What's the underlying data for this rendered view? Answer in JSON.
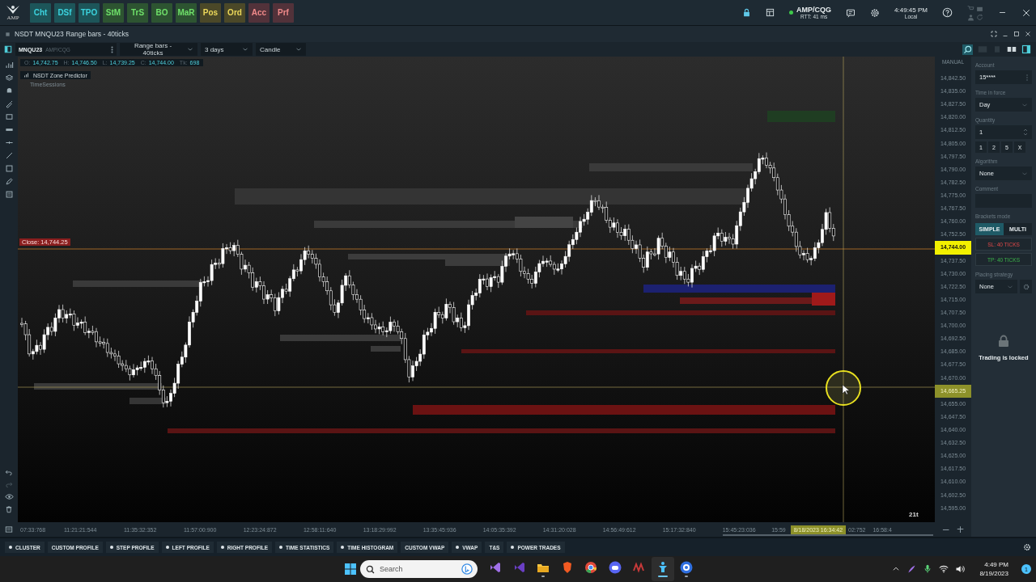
{
  "top_bar": {
    "logo": "AMP",
    "modules": [
      {
        "label": "Cht",
        "color": "#1d5559"
      },
      {
        "label": "DSf",
        "color": "#1d5559"
      },
      {
        "label": "TPO",
        "color": "#1d5559"
      },
      {
        "label": "StM",
        "color": "#2d5431"
      },
      {
        "label": "TrS",
        "color": "#2d5431"
      },
      {
        "label": "BO",
        "color": "#2d5431"
      },
      {
        "label": "MaR",
        "color": "#2d5431"
      },
      {
        "label": "Pos",
        "color": "#4b4828"
      },
      {
        "label": "Ord",
        "color": "#4b4828"
      },
      {
        "label": "Acc",
        "color": "#52323a"
      },
      {
        "label": "Prf",
        "color": "#52323a"
      }
    ],
    "connection": {
      "name": "AMP/CQG",
      "rtt": "RTT: 41 ms",
      "connected": true
    },
    "clock": {
      "time": "4:49:45 PM",
      "zone": "Local"
    }
  },
  "chart_window": {
    "title": "NSDT MNQU23 Range bars - 40ticks",
    "symbol": "MNQU23",
    "feed": "AMP/CQG",
    "bar_type": "Range bars - 40ticks",
    "period": "3 days",
    "style": "Candle"
  },
  "ohlc": [
    {
      "label": "O:",
      "value": "14,742.75"
    },
    {
      "label": "H:",
      "value": "14,746.50"
    },
    {
      "label": "L:",
      "value": "14,739.25"
    },
    {
      "label": "C:",
      "value": "14,744.00"
    },
    {
      "label": "Tk:",
      "value": "698"
    }
  ],
  "indicators": [
    {
      "name": "NSDT Zone Predictor",
      "disabled": false
    },
    {
      "name": "TimeSessions",
      "disabled": true
    }
  ],
  "close_label": "Close: 14,744.25",
  "bar_counter": "21t",
  "price_axis": {
    "mode": "MANUAL",
    "ticks": [
      {
        "text": "14,842.50",
        "kind": "tick"
      },
      {
        "text": "14,835.00",
        "kind": "tick"
      },
      {
        "text": "14,827.50",
        "kind": "tick"
      },
      {
        "text": "14,820.00",
        "kind": "tick"
      },
      {
        "text": "14,812.50",
        "kind": "tick"
      },
      {
        "text": "14,805.00",
        "kind": "tick"
      },
      {
        "text": "14,797.50",
        "kind": "tick"
      },
      {
        "text": "14,790.00",
        "kind": "tick"
      },
      {
        "text": "14,782.50",
        "kind": "tick"
      },
      {
        "text": "14,775.00",
        "kind": "tick"
      },
      {
        "text": "14,767.50",
        "kind": "tick"
      },
      {
        "text": "14,760.00",
        "kind": "tick"
      },
      {
        "text": "14,752.50",
        "kind": "tick"
      },
      {
        "text": "14,744.00",
        "kind": "last"
      },
      {
        "text": "14,737.50",
        "kind": "tick"
      },
      {
        "text": "14,730.00",
        "kind": "tick"
      },
      {
        "text": "14,722.50",
        "kind": "tick"
      },
      {
        "text": "14,715.00",
        "kind": "tick"
      },
      {
        "text": "14,707.50",
        "kind": "tick"
      },
      {
        "text": "14,700.00",
        "kind": "tick"
      },
      {
        "text": "14,692.50",
        "kind": "tick"
      },
      {
        "text": "14,685.00",
        "kind": "tick"
      },
      {
        "text": "14,677.50",
        "kind": "tick"
      },
      {
        "text": "14,670.00",
        "kind": "tick"
      },
      {
        "text": "14,665.25",
        "kind": "cursor"
      },
      {
        "text": "14,655.00",
        "kind": "tick"
      },
      {
        "text": "14,647.50",
        "kind": "tick"
      },
      {
        "text": "14,640.00",
        "kind": "tick"
      },
      {
        "text": "14,632.50",
        "kind": "tick"
      },
      {
        "text": "14,625.00",
        "kind": "tick"
      },
      {
        "text": "14,617.50",
        "kind": "tick"
      },
      {
        "text": "14,610.00",
        "kind": "tick"
      },
      {
        "text": "14,602.50",
        "kind": "tick"
      },
      {
        "text": "14,595.00",
        "kind": "tick"
      }
    ]
  },
  "time_axis": {
    "labels": [
      {
        "text": "07:33:768",
        "kind": "partial"
      },
      {
        "text": "11:21:21:544",
        "kind": "tick"
      },
      {
        "text": "11:35:32:352",
        "kind": "tick"
      },
      {
        "text": "11:57:00:900",
        "kind": "tick"
      },
      {
        "text": "12:23:24:872",
        "kind": "tick"
      },
      {
        "text": "12:58:11:640",
        "kind": "tick"
      },
      {
        "text": "13:18:29:992",
        "kind": "tick"
      },
      {
        "text": "13:35:45:936",
        "kind": "tick"
      },
      {
        "text": "14:05:35:392",
        "kind": "tick"
      },
      {
        "text": "14:31:20:028",
        "kind": "tick"
      },
      {
        "text": "14:56:49:612",
        "kind": "tick"
      },
      {
        "text": "15:17:32:840",
        "kind": "tick"
      },
      {
        "text": "15:45:23:036",
        "kind": "tick"
      },
      {
        "text": "15:59",
        "kind": "partial"
      },
      {
        "text": "8/18/2023 16:34:42",
        "kind": "cursor"
      },
      {
        "text": "02:752",
        "kind": "partial"
      },
      {
        "text": "16:58:4",
        "kind": "partial"
      }
    ],
    "zoom_out": "−",
    "zoom_in": "+"
  },
  "order_panel": {
    "account": {
      "label": "Account",
      "value": "15****"
    },
    "time_in_force": {
      "label": "Time in force",
      "value": "Day"
    },
    "quantity": {
      "label": "Quantity",
      "value": "1",
      "presets": [
        "1",
        "2",
        "5",
        "X"
      ]
    },
    "algorithm": {
      "label": "Algorithm",
      "value": "None"
    },
    "comment": {
      "label": "Comment"
    },
    "brackets": {
      "label": "Brackets mode",
      "modes": [
        {
          "label": "SIMPLE",
          "selected": true
        },
        {
          "label": "MULTI",
          "selected": false
        }
      ],
      "stop_loss": "SL: 40 TICKS",
      "take_profit": "TP: 40 TICKS"
    },
    "placing_strategy": {
      "label": "Placing strategy",
      "value": "None"
    },
    "lock_message": "Trading is locked"
  },
  "bottom_tabs": [
    {
      "label": "CLUSTER",
      "dot": true
    },
    {
      "label": "CUSTOM PROFILE",
      "dot": false
    },
    {
      "label": "STEP PROFILE",
      "dot": true
    },
    {
      "label": "LEFT PROFILE",
      "dot": true
    },
    {
      "label": "RIGHT PROFILE",
      "dot": true
    },
    {
      "label": "TIME STATISTICS",
      "dot": true
    },
    {
      "label": "TIME HISTOGRAM",
      "dot": true
    },
    {
      "label": "CUSTOM VWAP",
      "dot": false
    },
    {
      "label": "VWAP",
      "dot": true
    },
    {
      "label": "T&S",
      "dot": false
    },
    {
      "label": "POWER TRADES",
      "dot": true
    }
  ],
  "taskbar": {
    "search": {
      "placeholder": "Search"
    },
    "apps": [
      {
        "kind": "studio-purple",
        "running": false,
        "active": false
      },
      {
        "kind": "studio-dark",
        "running": false,
        "active": false
      },
      {
        "kind": "folder",
        "running": true,
        "active": false
      },
      {
        "kind": "lion",
        "running": false,
        "active": false
      },
      {
        "kind": "chrome",
        "running": false,
        "active": false
      },
      {
        "kind": "chat",
        "running": false,
        "active": false
      },
      {
        "kind": "wave",
        "running": false,
        "active": false
      },
      {
        "kind": "trader",
        "running": true,
        "active": true
      },
      {
        "kind": "robot",
        "running": true,
        "active": false
      }
    ],
    "time": "4:49 PM",
    "date": "8/19/2023",
    "notifications": "1"
  }
}
